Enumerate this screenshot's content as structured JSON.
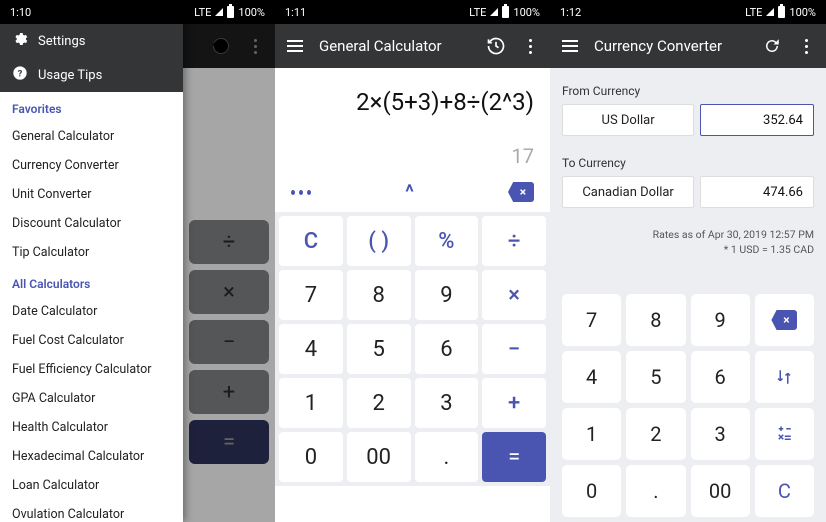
{
  "status": {
    "time1": "1:10",
    "time2": "1:11",
    "time3": "1:12",
    "net": "LTE",
    "batt": "100%"
  },
  "drawer": {
    "settings": "Settings",
    "tips": "Usage Tips",
    "fav_header": "Favorites",
    "favorites": [
      "General Calculator",
      "Currency Converter",
      "Unit Converter",
      "Discount Calculator",
      "Tip Calculator"
    ],
    "all_header": "All Calculators",
    "all": [
      "Date Calculator",
      "Fuel Cost Calculator",
      "Fuel Efficiency Calculator",
      "GPA Calculator",
      "Health Calculator",
      "Hexadecimal Calculator",
      "Loan Calculator",
      "Ovulation Calculator"
    ]
  },
  "calc": {
    "title": "General Calculator",
    "expr": "2×(5+3)+8÷(2^3)",
    "result": "17",
    "keys": [
      "C",
      "( )",
      "%",
      "÷",
      "7",
      "8",
      "9",
      "×",
      "4",
      "5",
      "6",
      "−",
      "1",
      "2",
      "3",
      "+",
      "0",
      "00",
      ".",
      "="
    ],
    "ops": [
      "C",
      "( )",
      "%",
      "÷",
      "×",
      "−",
      "+"
    ],
    "caret": "^",
    "bs": "×"
  },
  "dim": {
    "ops": [
      "÷",
      "×",
      "−",
      "+",
      "="
    ]
  },
  "cc": {
    "title": "Currency Converter",
    "from_label": "From Currency",
    "from_cur": "US Dollar",
    "from_val": "352.64",
    "to_label": "To Currency",
    "to_cur": "Canadian Dollar",
    "to_val": "474.66",
    "rate1": "Rates as of Apr 30, 2019 12:57 PM",
    "rate2": "* 1 USD = 1.35 CAD",
    "keys": [
      "7",
      "8",
      "9",
      "BS",
      "4",
      "5",
      "6",
      "SWAP",
      "1",
      "2",
      "3",
      "CALC",
      "0",
      ".",
      "00",
      "C"
    ]
  }
}
